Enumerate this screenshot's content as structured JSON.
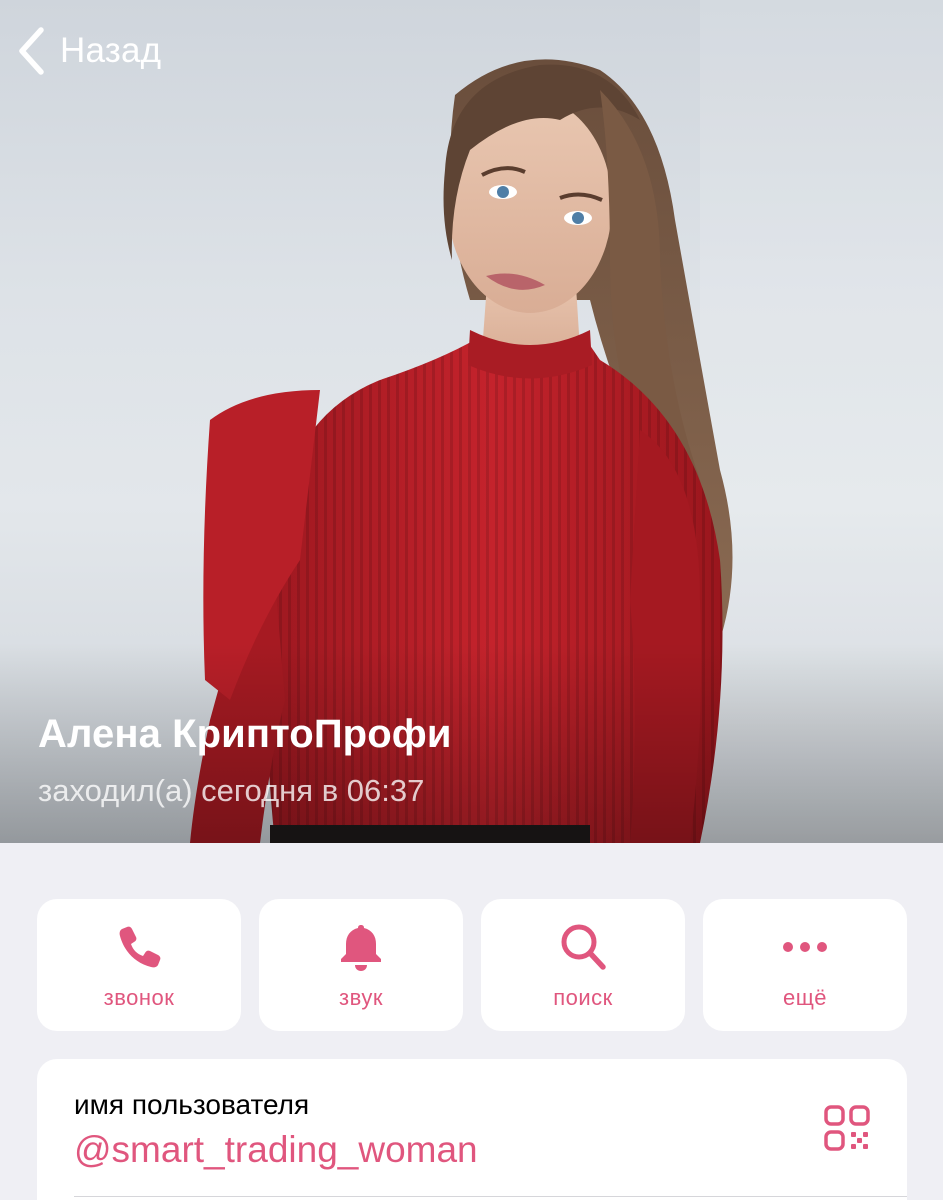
{
  "nav": {
    "back_label": "Назад"
  },
  "profile": {
    "name": "Алена КриптоПрофи",
    "last_seen": "заходил(а) сегодня в 06:37"
  },
  "actions": [
    {
      "label": "звонок",
      "icon": "phone-icon"
    },
    {
      "label": "звук",
      "icon": "bell-icon"
    },
    {
      "label": "поиск",
      "icon": "search-icon"
    },
    {
      "label": "ещё",
      "icon": "more-dots-icon"
    }
  ],
  "username_card": {
    "caption": "имя пользователя",
    "handle": "@smart_trading_woman",
    "qr_icon": "qr-code-icon"
  },
  "colors": {
    "accent": "#e0567e",
    "background": "#efeff4",
    "card": "#ffffff",
    "sweater": "#b81d26"
  }
}
